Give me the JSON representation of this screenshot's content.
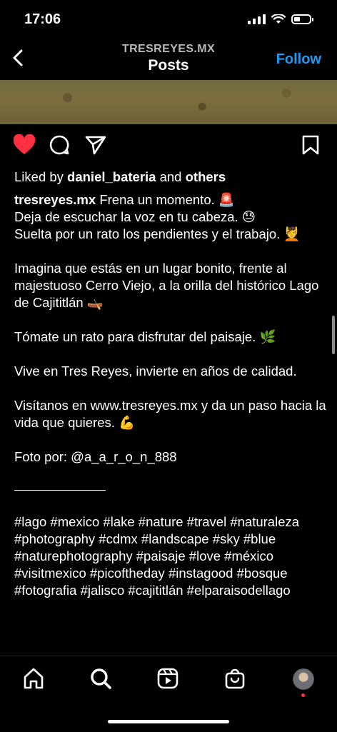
{
  "status_bar": {
    "time": "17:06",
    "battery_percent": 25
  },
  "header": {
    "username": "TRESREYES.MX",
    "title": "Posts",
    "follow_label": "Follow"
  },
  "actions": {
    "like_icon": "heart-filled-icon",
    "comment_icon": "comment-icon",
    "share_icon": "send-icon",
    "save_icon": "bookmark-icon",
    "like_color": "#ff3040"
  },
  "likes": {
    "prefix": "Liked by ",
    "user": "daniel_bateria",
    "middle": " and ",
    "others": "others"
  },
  "caption": {
    "author": "tresreyes.mx",
    "line1": "Frena un momento. 🚨",
    "line2": "Deja de escuchar la voz en tu cabeza. 😓",
    "line3": "Suelta por un rato los pendientes y el trabajo. 💆",
    "para2": "Imagina que estás en un lugar bonito, frente al majestuoso Cerro Viejo, a la orilla del histórico Lago de Cajititlán 🛶",
    "para3": "Tómate un rato para disfrutar del paisaje. 🌿",
    "para4": "Vive en Tres Reyes, invierte en años de calidad.",
    "para5": "Visítanos en www.tresreyes.mx y da un paso hacia la vida que quieres. 💪",
    "para6": "Foto por: @a_a_r_o_n_888",
    "hashtags": "#lago #mexico #lake #nature #travel #naturaleza #photography #cdmx #landscape #sky #blue #naturephotography #paisaje #love #méxico #visitmexico #picoftheday #instagood #bosque #fotografia  #jalisco #cajititlán #elparaisodellago"
  },
  "bottom_nav": {
    "items": [
      "home-icon",
      "search-icon",
      "reels-icon",
      "shop-icon",
      "profile-avatar"
    ],
    "accent": "#ff2d55"
  }
}
